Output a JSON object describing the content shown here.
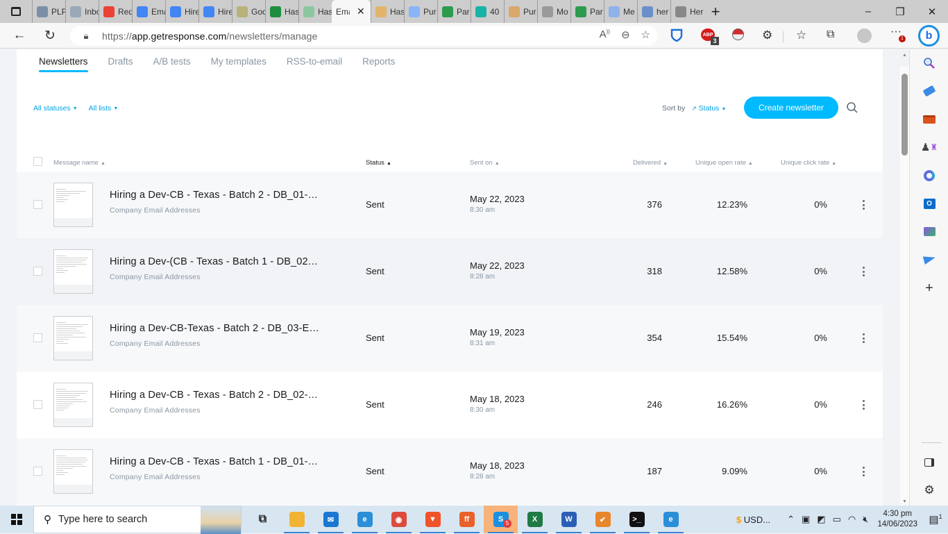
{
  "browser": {
    "tabs": [
      {
        "label": "PLP",
        "icon": "plp-icon",
        "color": "#7b8fa8"
      },
      {
        "label": "Inbox",
        "icon": "inbox-icon",
        "color": "#9aa9b8"
      },
      {
        "label": "Req",
        "icon": "gmail-icon",
        "color": "#ea4335"
      },
      {
        "label": "Ema",
        "icon": "google-docs-icon",
        "color": "#4285f4"
      },
      {
        "label": "Hire",
        "icon": "google-docs-icon",
        "color": "#4285f4"
      },
      {
        "label": "Hire",
        "icon": "google-docs-icon",
        "color": "#4285f4"
      },
      {
        "label": "Goo",
        "icon": "google-maps-icon",
        "color": "#b6b27a"
      },
      {
        "label": "Has",
        "icon": "google-sheets-icon",
        "color": "#1e8e3e"
      },
      {
        "label": "Has",
        "icon": "google-sheets-icon",
        "color": "#8cc7a0"
      },
      {
        "label": "Ema",
        "icon": "getresponse-icon",
        "color": "#00baff",
        "active": true
      },
      {
        "label": "Has",
        "icon": "slides-icon",
        "color": "#e2b46a"
      },
      {
        "label": "Pur",
        "icon": "calendar-icon",
        "color": "#8ab4f8"
      },
      {
        "label": "Par",
        "icon": "robot-icon",
        "color": "#2d9b4e"
      },
      {
        "label": "40",
        "icon": "site-icon",
        "color": "#18b3a5"
      },
      {
        "label": "Pur",
        "icon": "check-icon",
        "color": "#d9a86b"
      },
      {
        "label": "Mo",
        "icon": "openai-icon",
        "color": "#9a9a9a"
      },
      {
        "label": "Par",
        "icon": "robot-icon",
        "color": "#2d9b4e"
      },
      {
        "label": "Me",
        "icon": "sparkle-icon",
        "color": "#8fb3e8"
      },
      {
        "label": "her",
        "icon": "search-icon",
        "color": "#6b8fc8"
      },
      {
        "label": "Her",
        "icon": "h-icon",
        "color": "#888888"
      }
    ],
    "active_close": "✕",
    "new_tab": "+",
    "window_controls": {
      "minimize": "–",
      "restore": "❐",
      "close": "✕"
    },
    "url_scheme": "https://",
    "url_host": "app.getresponse.com",
    "url_path": "/newsletters/manage",
    "abp_count": "3",
    "abp_label": "ABP",
    "more_badge": "1",
    "bing_label": "b"
  },
  "app": {
    "subnav": [
      {
        "label": "Newsletters",
        "active": true
      },
      {
        "label": "Drafts"
      },
      {
        "label": "A/B tests"
      },
      {
        "label": "My templates"
      },
      {
        "label": "RSS-to-email"
      },
      {
        "label": "Reports"
      }
    ],
    "filters": {
      "statuses": "All statuses",
      "lists": "All lists"
    },
    "sort": {
      "label": "Sort by",
      "value": "Status"
    },
    "create_button": "Create newsletter",
    "columns": {
      "name": "Message name",
      "status": "Status",
      "sent_on": "Sent on",
      "delivered": "Delivered",
      "open_rate": "Unique open rate",
      "click_rate": "Unique click rate"
    },
    "rows": [
      {
        "name": "Hiring a Dev-CB - Texas - Batch 2 - DB_01-…",
        "list": "Company Email Addresses",
        "status": "Sent",
        "date": "May 22, 2023",
        "time": "8:30 am",
        "delivered": "376",
        "open_rate": "12.23%",
        "click_rate": "0%",
        "bg": "#f6f8fa"
      },
      {
        "name": "Hiring a Dev-(CB - Texas - Batch 1 - DB_02…",
        "list": "Company Email Addresses",
        "status": "Sent",
        "date": "May 22, 2023",
        "time": "8:28 am",
        "delivered": "318",
        "open_rate": "12.58%",
        "click_rate": "0%",
        "bg": "#f1f3f7"
      },
      {
        "name": "Hiring a Dev-CB-Texas - Batch 2 - DB_03-E…",
        "list": "Company Email Addresses",
        "status": "Sent",
        "date": "May 19, 2023",
        "time": "8:31 am",
        "delivered": "354",
        "open_rate": "15.54%",
        "click_rate": "0%",
        "bg": "#f6f8fa"
      },
      {
        "name": "Hiring a Dev-CB - Texas - Batch 2 - DB_02-…",
        "list": "Company Email Addresses",
        "status": "Sent",
        "date": "May 18, 2023",
        "time": "8:30 am",
        "delivered": "246",
        "open_rate": "16.26%",
        "click_rate": "0%",
        "bg": "#ffffff"
      },
      {
        "name": "Hiring a Dev-CB - Texas - Batch 1 - DB_01-…",
        "list": "Company Email Addresses",
        "status": "Sent",
        "date": "May 18, 2023",
        "time": "8:28 am",
        "delivered": "187",
        "open_rate": "9.09%",
        "click_rate": "0%",
        "bg": "#f6f8fa"
      }
    ]
  },
  "taskbar": {
    "search_placeholder": "Type here to search",
    "apps": [
      {
        "name": "task-view",
        "glyph": "⧉",
        "color": "transparent",
        "run": false
      },
      {
        "name": "file-explorer",
        "glyph": "",
        "color": "#f2b233",
        "run": true
      },
      {
        "name": "mail",
        "glyph": "✉",
        "color": "#1a78d2",
        "run": true
      },
      {
        "name": "edge",
        "glyph": "e",
        "color": "#2a8fd8",
        "run": true
      },
      {
        "name": "chrome",
        "glyph": "◉",
        "color": "#dd4b3e",
        "run": true
      },
      {
        "name": "brave",
        "glyph": "▼",
        "color": "#f0522a",
        "run": true
      },
      {
        "name": "firefox",
        "glyph": "ff",
        "color": "#e8612a",
        "run": true
      },
      {
        "name": "skype",
        "glyph": "S",
        "color": "#1b8fe0",
        "run": true,
        "badge": "5",
        "highlight": true
      },
      {
        "name": "excel",
        "glyph": "X",
        "color": "#1f7a44",
        "run": true
      },
      {
        "name": "word",
        "glyph": "W",
        "color": "#2b5fb6",
        "run": true
      },
      {
        "name": "clock-app",
        "glyph": "✔",
        "color": "#e8862a",
        "run": true
      },
      {
        "name": "terminal",
        "glyph": ">_",
        "color": "#111111",
        "run": true
      },
      {
        "name": "edge-profile",
        "glyph": "e",
        "color": "#2a8fd8",
        "run": true
      }
    ],
    "tray_widget": "USD...",
    "time": "4:30 pm",
    "date": "14/06/2023",
    "notification_count": "1"
  }
}
